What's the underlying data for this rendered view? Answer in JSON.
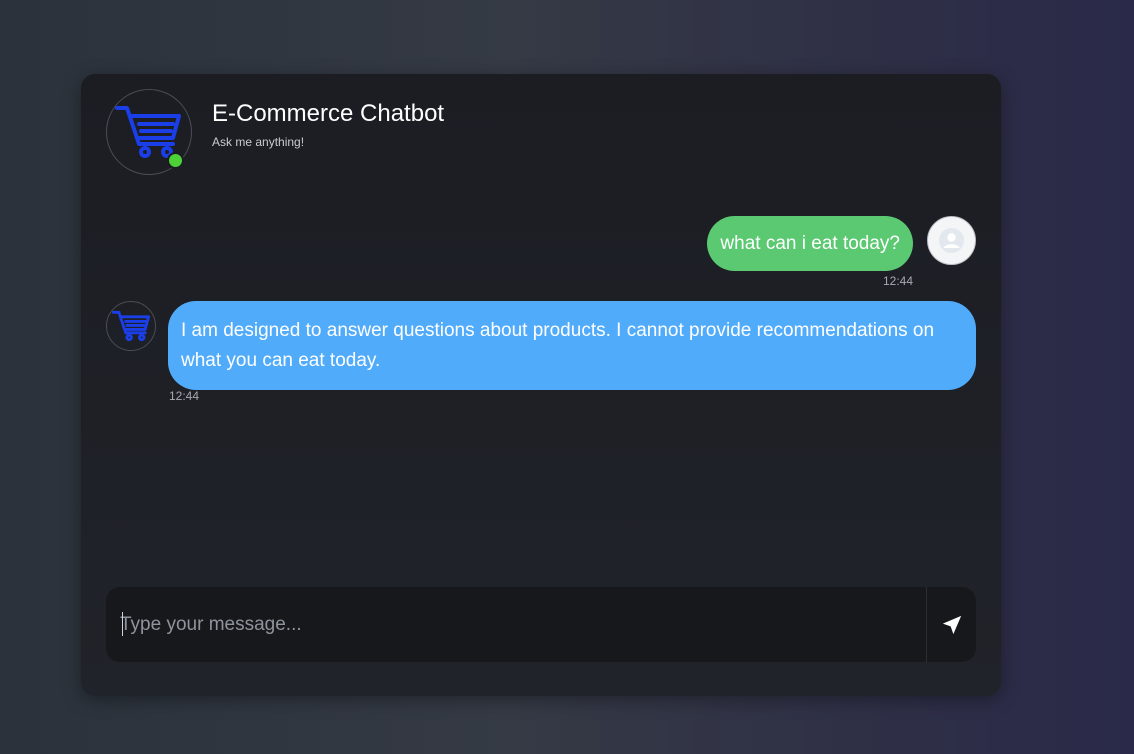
{
  "header": {
    "title": "E-Commerce Chatbot",
    "subtitle": "Ask me anything!",
    "avatar_icon": "shopping-cart-icon",
    "status": "online",
    "status_color": "#4cd137"
  },
  "messages": [
    {
      "sender": "user",
      "text": "what can i eat today?",
      "time": "12:44",
      "bubble_color": "#5bc971",
      "avatar_icon": "user-icon"
    },
    {
      "sender": "bot",
      "text": "I am designed to answer questions about products. I cannot provide recommendations on what you can eat today.",
      "time": "12:44",
      "bubble_color": "#51abfb",
      "avatar_icon": "shopping-cart-icon"
    }
  ],
  "composer": {
    "value": "",
    "placeholder": "Type your message...",
    "send_icon": "send-icon"
  },
  "colors": {
    "card_background": "#1b1d23",
    "cart_icon": "#1a3fe8",
    "text": "#ffffff"
  }
}
